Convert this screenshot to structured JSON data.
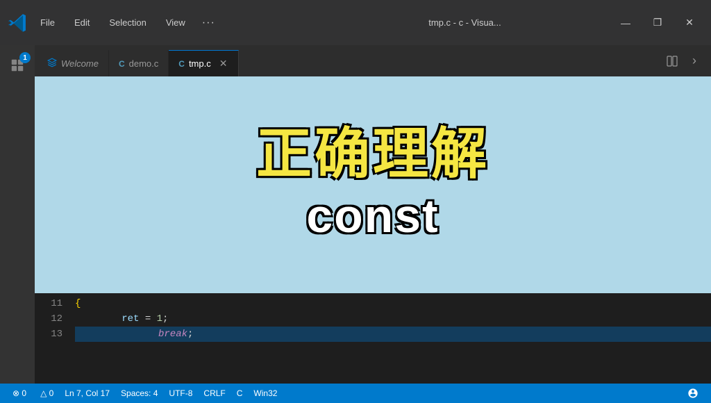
{
  "titlebar": {
    "menu_file": "File",
    "menu_edit": "Edit",
    "menu_selection": "Selection",
    "menu_view": "View",
    "menu_more": "···",
    "window_title": "tmp.c - c - Visua...",
    "minimize": "—",
    "maximize": "❐",
    "close": "✕"
  },
  "tabs": [
    {
      "id": "welcome",
      "label": "Welcome",
      "icon": "⚡",
      "icon_type": "vscode",
      "active": false,
      "closable": false
    },
    {
      "id": "demo",
      "label": "demo.c",
      "icon": "C",
      "icon_type": "c",
      "active": false,
      "closable": false
    },
    {
      "id": "tmp",
      "label": "tmp.c",
      "icon": "C",
      "icon_type": "c",
      "active": true,
      "closable": true
    }
  ],
  "overlay": {
    "zh_text": "正确理解",
    "en_text": "const",
    "bg_color": "#b0d8e8"
  },
  "code": {
    "lines": [
      {
        "num": "11",
        "content": "{",
        "type": "brace",
        "highlighted": false
      },
      {
        "num": "12",
        "content": "ret = 1;",
        "type": "assign",
        "highlighted": false
      },
      {
        "num": "13",
        "content": "break;",
        "type": "keyword",
        "highlighted": true
      }
    ]
  },
  "statusbar": {
    "errors": "⊗ 0",
    "warnings": "△ 0",
    "position": "Ln 7, Col 17",
    "spaces": "Spaces: 4",
    "encoding": "UTF-8",
    "line_ending": "CRLF",
    "language": "C",
    "platform": "Win32",
    "feedback_icon": "👤"
  }
}
